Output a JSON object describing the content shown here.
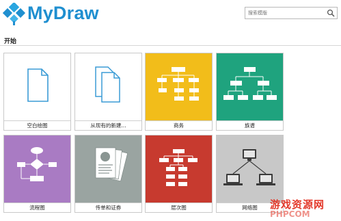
{
  "app": {
    "name": "MyDraw",
    "brand_color": "#1f8fd0"
  },
  "search": {
    "placeholder": "搜索模版",
    "icon": "search-icon"
  },
  "section": {
    "title": "开始"
  },
  "templates": [
    {
      "id": "blank",
      "label": "空白绘图",
      "bg": "#ffffff",
      "icon": "blank-document-icon"
    },
    {
      "id": "existing",
      "label": "从现有的新建...",
      "bg": "#ffffff",
      "icon": "copy-documents-icon"
    },
    {
      "id": "business",
      "label": "商务",
      "bg": "#f2bd1a",
      "icon": "org-chart-icon"
    },
    {
      "id": "family",
      "label": "族谱",
      "bg": "#1fa37e",
      "icon": "family-tree-icon"
    },
    {
      "id": "flowchart",
      "label": "流程图",
      "bg": "#a97bc3",
      "icon": "flowchart-icon"
    },
    {
      "id": "flyer",
      "label": "传单和证券",
      "bg": "#9aa4a1",
      "icon": "flyer-icon"
    },
    {
      "id": "hierarchy",
      "label": "层次图",
      "bg": "#c73a2f",
      "icon": "hierarchy-icon"
    },
    {
      "id": "network",
      "label": "网络图",
      "bg": "#c8c8c8",
      "icon": "network-icon"
    }
  ],
  "watermark": {
    "text": "游戏资源网",
    "url": "PHPCOM"
  }
}
